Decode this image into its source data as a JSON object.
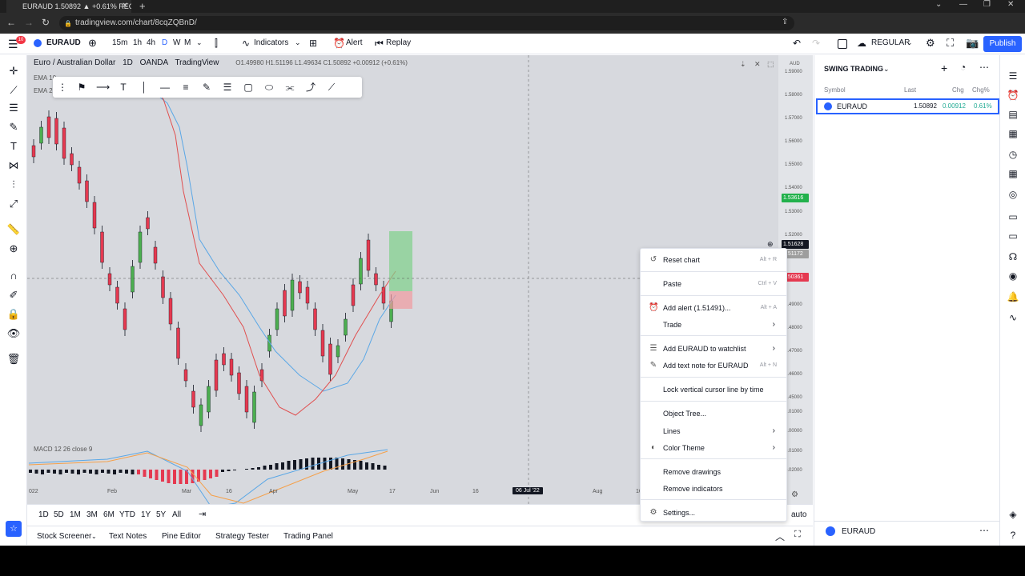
{
  "browser": {
    "tab_title": "EURAUD 1.50892 ▲ +0.61% REG",
    "url": "tradingview.com/chart/8cqZQBnD/",
    "notifications": "10"
  },
  "toolbar": {
    "symbol": "EURAUD",
    "intervals": [
      "15m",
      "1h",
      "4h",
      "D",
      "W",
      "M"
    ],
    "indicators_label": "Indicators",
    "alert_label": "Alert",
    "replay_label": "Replay",
    "layout_label": "REGULAR",
    "publish_label": "Publish"
  },
  "chart": {
    "title": "Euro / Australian Dollar",
    "timeframe": "1D",
    "source": "OANDA",
    "brand": "TradingView",
    "ohlc": "O1.49980 H1.51196 L1.49634 C1.50892 +0.00912 (+0.61%)",
    "ema1": "EMA 10",
    "ema2": "EMA 20",
    "macd_label": "MACD 12 26 close 9",
    "axis_currency": "AUD",
    "price_ticks": [
      "1.59000",
      "1.58000",
      "1.57000",
      "1.56000",
      "1.55000",
      "1.54000",
      "1.53000",
      "1.52000",
      "1.49000",
      "1.48000",
      "1.47000",
      "1.46000",
      "1.45000",
      "1.01000",
      "1.00000",
      "0.01000",
      "0.02000"
    ],
    "price_label_green": "1.53616",
    "price_label_current": "1.51628",
    "price_label_gray": "1.51172",
    "price_label_red": "1.50361",
    "time_labels": [
      "022",
      "Feb",
      "Mar",
      "16",
      "Apr",
      "May",
      "17",
      "Jun",
      "16",
      "Aug",
      "16"
    ],
    "crosshair_date": "06 Jul '22",
    "scale_mode": "auto"
  },
  "ranges": [
    "1D",
    "5D",
    "1M",
    "3M",
    "6M",
    "YTD",
    "1Y",
    "5Y",
    "All"
  ],
  "bottom_tabs": [
    "Stock Screener",
    "Text Notes",
    "Pine Editor",
    "Strategy Tester",
    "Trading Panel"
  ],
  "context_menu": {
    "reset_chart": "Reset chart",
    "reset_chart_shortcut": "Alt + R",
    "paste": "Paste",
    "paste_shortcut": "Ctrl + V",
    "add_alert": "Add alert (1.51491)...",
    "add_alert_shortcut": "Alt + A",
    "trade": "Trade",
    "add_watchlist": "Add EURAUD to watchlist",
    "add_text_note": "Add text note for EURAUD",
    "add_text_note_shortcut": "Alt + N",
    "lock_cursor": "Lock vertical cursor line by time",
    "object_tree": "Object Tree...",
    "lines": "Lines",
    "color_theme": "Color Theme",
    "remove_drawings": "Remove drawings",
    "remove_indicators": "Remove indicators",
    "settings": "Settings..."
  },
  "watchlist": {
    "title": "SWING TRADING",
    "col_symbol": "Symbol",
    "col_last": "Last",
    "col_chg": "Chg",
    "col_chgp": "Chg%",
    "row": {
      "symbol": "EURAUD",
      "last": "1.50892",
      "chg": "0.00912",
      "chgp": "0.61%"
    },
    "bottom_symbol": "EURAUD"
  },
  "colors": {
    "up": "#26a69a",
    "candle_up": "#4caf50",
    "candle_down": "#e53950",
    "accent": "#2962ff"
  }
}
